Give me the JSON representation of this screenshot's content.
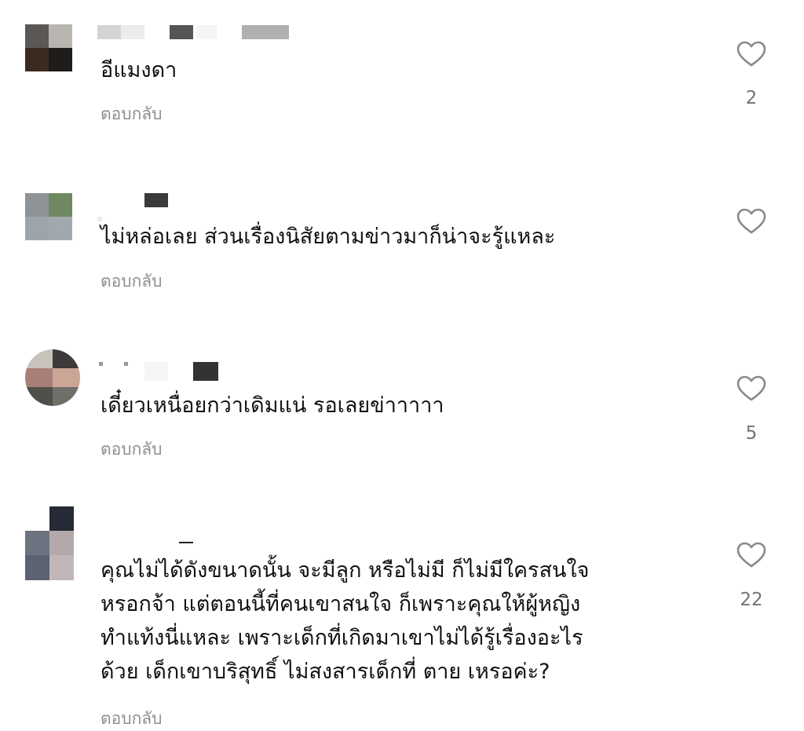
{
  "colors": {
    "background": "#ffffff",
    "text": "#111111",
    "secondary_text": "#8e8e8e",
    "like_count": "#737373",
    "icon_stroke": "#8a8a8a"
  },
  "icons": {
    "like": "heart-outline-icon"
  },
  "comments": [
    {
      "username": "",
      "text": "อีแมงดา",
      "reply_label": "ตอบกลับ",
      "like_count": "2"
    },
    {
      "username": "",
      "text": "ไม่หล่อเลย ส่วนเรื่องนิสัยตามข่าวมาก็น่าจะรู้แหละ",
      "reply_label": "ตอบกลับ",
      "like_count": ""
    },
    {
      "username": "",
      "text": "เดี๋ยวเหนื่อยกว่าเดิมแน่ รอเลยข่าาาาา",
      "reply_label": "ตอบกลับ",
      "like_count": "5"
    },
    {
      "username": "",
      "text": "คุณไม่ได้ดังขนาดนั้น จะมีลูก หรือไม่มี ก็ไม่มีใครสนใจ\nหรอกจ้า แต่ตอนนี้ที่คนเขาสนใจ ก็เพราะคุณให้ผู้หญิง\nทำแท้งนี่แหละ เพราะเด็กที่เกิดมาเขาไม่ได้รู้เรื่องอะไร\nด้วย เด็กเขาบริสุทธิ์ ไม่สงสารเด็กที่ ตาย เหรอค่ะ?",
      "reply_label": "ตอบกลับ",
      "like_count": "22"
    }
  ]
}
